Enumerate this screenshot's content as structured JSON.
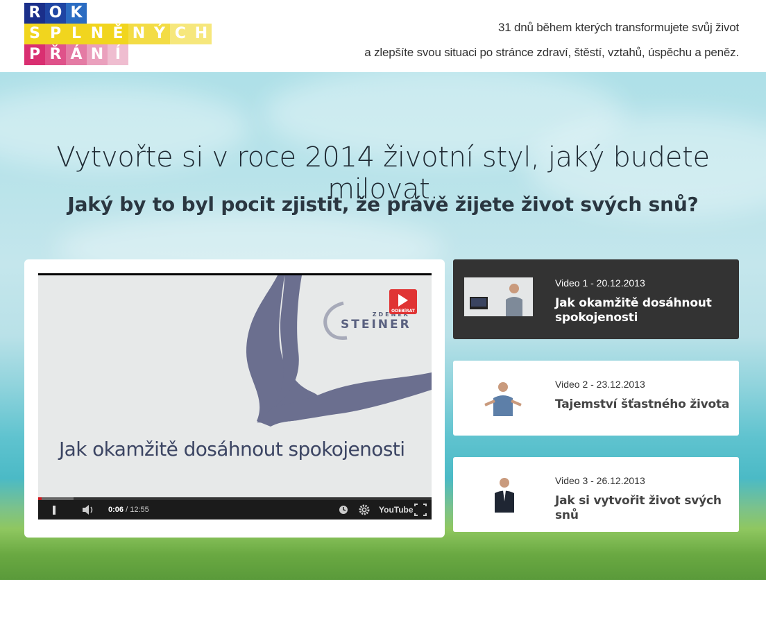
{
  "logo": {
    "row1": [
      "R",
      "O",
      "K"
    ],
    "row2": [
      "S",
      "P",
      "L",
      "N",
      "Ě",
      "N",
      "Ý",
      "C",
      "H"
    ],
    "row3": [
      "P",
      "Ř",
      "Á",
      "N",
      "Í"
    ]
  },
  "header": {
    "tagline_line1": "31 dnů během kterých transformujete svůj život",
    "tagline_line2": "a zlepšíte svou situaci po stránce zdraví, štěstí, vztahů, úspěchu a peněz."
  },
  "hero": {
    "title": "Vytvořte si v roce 2014 životní styl, jaký budete milovat.",
    "subtitle": "Jaký by to byl pocit zjistit, že právě žijete život svých snů?"
  },
  "player": {
    "brand_small": "ZDENĚK",
    "brand_big": "STEINER",
    "subscribe_label": "ODEBÍRAT",
    "caption": "Jak okamžitě dosáhnout spokojenosti",
    "time_current": "0:06",
    "time_total": "/ 12:55",
    "youtube_label": "YouTube",
    "played_fraction": 0.008,
    "loaded_fraction": 0.09,
    "colors": {
      "accent": "#cc181e",
      "bubble": "#6b6f8f"
    }
  },
  "videos": [
    {
      "meta": "Video 1 - 20.12.2013",
      "title": "Jak okamžitě dosáhnout spokojenosti",
      "active": true
    },
    {
      "meta": "Video 2 - 23.12.2013",
      "title": "Tajemství šťastného života",
      "active": false
    },
    {
      "meta": "Video 3 - 26.12.2013",
      "title": "Jak si vytvořit život svých snů",
      "active": false
    }
  ]
}
